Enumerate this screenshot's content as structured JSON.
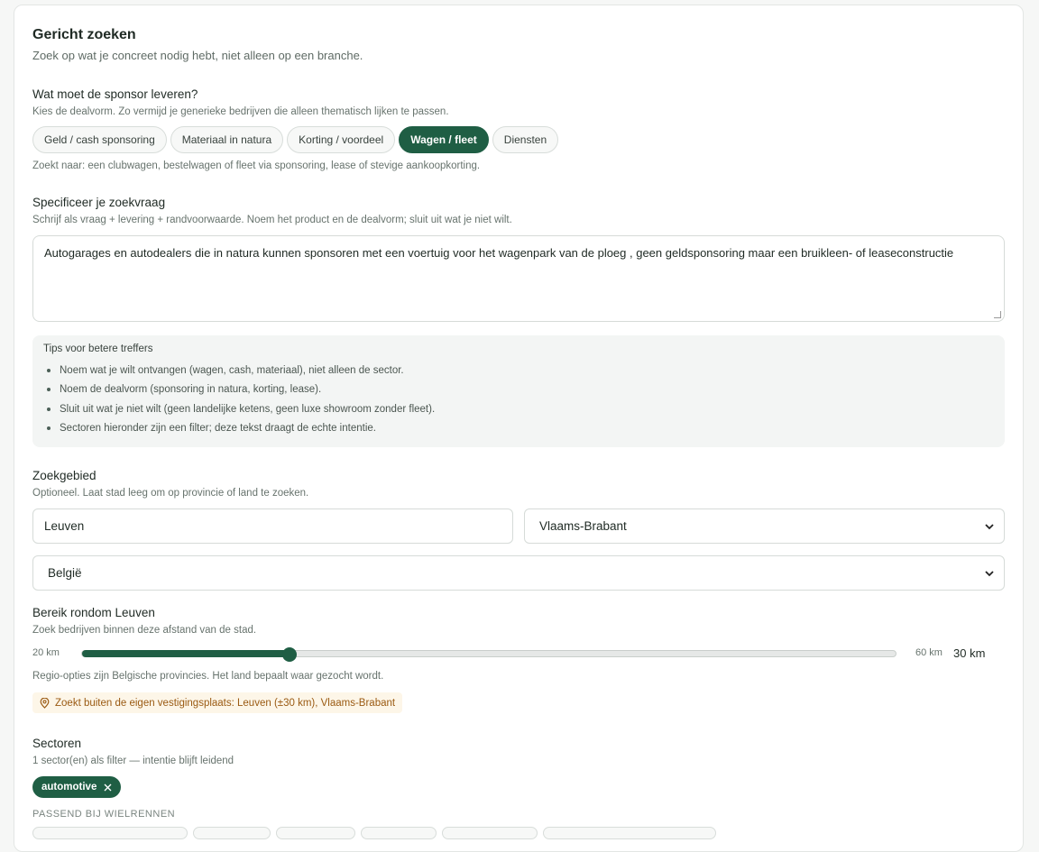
{
  "header": {
    "title": "Gericht zoeken",
    "subtitle": "Zoek op wat je concreet nodig hebt, niet alleen op een branche."
  },
  "deal": {
    "label": "Wat moet de sponsor leveren?",
    "hint": "Kies de dealvorm. Zo vermijd je generieke bedrijven die alleen thematisch lijken te passen.",
    "options": [
      {
        "label": "Geld / cash sponsoring",
        "active": false
      },
      {
        "label": "Materiaal in natura",
        "active": false
      },
      {
        "label": "Korting / voordeel",
        "active": false
      },
      {
        "label": "Wagen / fleet",
        "active": true
      },
      {
        "label": "Diensten",
        "active": false
      }
    ],
    "note": "Zoekt naar: een clubwagen, bestelwagen of fleet via sponsoring, lease of stevige aankoopkorting."
  },
  "query": {
    "label": "Specificeer je zoekvraag",
    "hint": "Schrijf als vraag + levering + randvoorwaarde. Noem het product en de dealvorm; sluit uit wat je niet wilt.",
    "value": "Autogarages en autodealers die in natura kunnen sponsoren met een voertuig voor het wagenpark van de ploeg , geen geldsponsoring maar een bruikleen- of leaseconstructie"
  },
  "tips": {
    "title": "Tips voor betere treffers",
    "items": [
      "Noem wat je wilt ontvangen (wagen, cash, materiaal), niet alleen de sector.",
      "Noem de dealvorm (sponsoring in natura, korting, lease).",
      "Sluit uit wat je niet wilt (geen landelijke ketens, geen luxe showroom zonder fleet).",
      "Sectoren hieronder zijn een filter; deze tekst draagt de echte intentie."
    ]
  },
  "area": {
    "label": "Zoekgebied",
    "hint": "Optioneel. Laat stad leeg om op provincie of land te zoeken.",
    "city": "Leuven",
    "province": "Vlaams-Brabant",
    "country": "België"
  },
  "range": {
    "label": "Bereik rondom Leuven",
    "hint": "Zoek bedrijven binnen deze afstand van de stad.",
    "min_label": "20 km",
    "max_label": "60 km",
    "value_label": "30 km",
    "min": 20,
    "max": 60,
    "value": 30,
    "note": "Regio-opties zijn Belgische provincies. Het land bepaalt waar gezocht wordt.",
    "notice": "Zoekt buiten de eigen vestigingsplaats: Leuven (±30 km), Vlaams-Brabant"
  },
  "sectors": {
    "label": "Sectoren",
    "hint": "1 sector(en) als filter — intentie blijft leidend",
    "selected": "automotive",
    "suggest_label": "PASSEND BIJ WIELRENNEN"
  },
  "colors": {
    "accent": "#1f5e44",
    "notice_text": "#9a5a12",
    "notice_bg": "#fdf6e8"
  }
}
